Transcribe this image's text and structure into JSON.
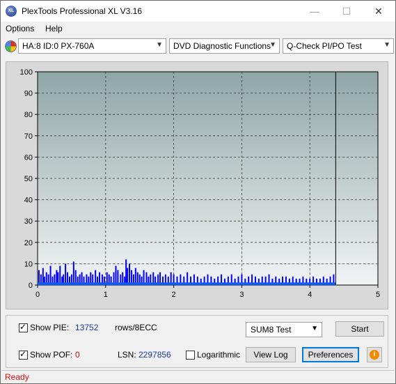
{
  "app": {
    "title": "PlexTools Professional XL V3.16",
    "icon_label": "XL"
  },
  "window_controls": {
    "minimize": "—",
    "maximize": "☐",
    "close": "✕"
  },
  "menu": {
    "options": "Options",
    "help": "Help"
  },
  "toolbar": {
    "drive": "HA:8 ID:0  PX-760A",
    "function": "DVD Diagnostic Functions",
    "test": "Q-Check PI/PO Test"
  },
  "chart_data": {
    "type": "bar",
    "title": "",
    "xlabel": "",
    "ylabel": "",
    "xlim": [
      0,
      5
    ],
    "ylim": [
      0,
      100
    ],
    "x_ticks": [
      "0",
      "1",
      "2",
      "3",
      "4",
      "5"
    ],
    "y_ticks": [
      "0",
      "10",
      "20",
      "30",
      "40",
      "50",
      "60",
      "70",
      "80",
      "90",
      "100"
    ],
    "grid": true,
    "end_marker_x": 4.38,
    "series": [
      {
        "name": "PIE",
        "color": "#0000ff",
        "x": [
          0.02,
          0.05,
          0.08,
          0.1,
          0.13,
          0.16,
          0.19,
          0.22,
          0.25,
          0.28,
          0.3,
          0.33,
          0.36,
          0.38,
          0.41,
          0.44,
          0.47,
          0.5,
          0.53,
          0.56,
          0.59,
          0.62,
          0.65,
          0.68,
          0.72,
          0.75,
          0.78,
          0.81,
          0.85,
          0.88,
          0.91,
          0.95,
          0.98,
          1.02,
          1.05,
          1.08,
          1.12,
          1.15,
          1.18,
          1.22,
          1.25,
          1.28,
          1.3,
          1.32,
          1.35,
          1.38,
          1.41,
          1.44,
          1.47,
          1.5,
          1.53,
          1.56,
          1.6,
          1.63,
          1.66,
          1.7,
          1.73,
          1.77,
          1.8,
          1.84,
          1.88,
          1.92,
          1.96,
          2.0,
          2.05,
          2.1,
          2.15,
          2.2,
          2.25,
          2.3,
          2.35,
          2.4,
          2.45,
          2.5,
          2.55,
          2.6,
          2.65,
          2.7,
          2.75,
          2.8,
          2.85,
          2.9,
          2.95,
          3.0,
          3.05,
          3.1,
          3.15,
          3.2,
          3.25,
          3.3,
          3.35,
          3.4,
          3.45,
          3.5,
          3.55,
          3.6,
          3.65,
          3.7,
          3.75,
          3.8,
          3.85,
          3.9,
          3.95,
          4.0,
          4.05,
          4.1,
          4.15,
          4.2,
          4.25,
          4.3,
          4.35
        ],
        "values": [
          7,
          5,
          8,
          4,
          6,
          5,
          9,
          4,
          5,
          7,
          6,
          9,
          4,
          5,
          10,
          6,
          4,
          5,
          11,
          7,
          4,
          5,
          6,
          4,
          5,
          4,
          6,
          5,
          7,
          4,
          6,
          5,
          4,
          6,
          5,
          4,
          6,
          9,
          7,
          5,
          6,
          4,
          12,
          8,
          10,
          7,
          5,
          8,
          6,
          5,
          4,
          7,
          6,
          4,
          5,
          6,
          4,
          5,
          6,
          4,
          5,
          4,
          6,
          5,
          4,
          5,
          4,
          6,
          4,
          5,
          4,
          3,
          4,
          5,
          4,
          3,
          4,
          5,
          3,
          4,
          5,
          3,
          4,
          5,
          3,
          4,
          5,
          4,
          3,
          4,
          4,
          5,
          3,
          4,
          3,
          4,
          4,
          3,
          4,
          3,
          3,
          4,
          3,
          3,
          4,
          3,
          3,
          4,
          3,
          4,
          5
        ]
      }
    ]
  },
  "panel": {
    "show_pie_label": "Show PIE:",
    "pie_value": "13752",
    "rows_label": "rows/8ECC",
    "show_pof_label": "Show POF:",
    "pof_value": "0",
    "lsn_label": "LSN:",
    "lsn_value": "2297856",
    "logarithmic_label": "Logarithmic",
    "test_select": "SUM8 Test",
    "start_button": "Start",
    "view_log_button": "View Log",
    "preferences_button": "Preferences",
    "info_icon": "i"
  },
  "status": {
    "text": "Ready"
  }
}
